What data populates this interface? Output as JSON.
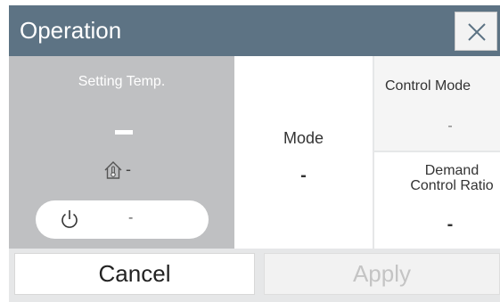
{
  "dialog": {
    "title": "Operation",
    "close_icon": "close-icon"
  },
  "setting": {
    "label": "Setting Temp.",
    "value": "-",
    "room_icon": "room-temperature-icon",
    "room_value": "-",
    "power_icon": "power-icon",
    "power_value": "-"
  },
  "mode": {
    "label": "Mode",
    "value": "-"
  },
  "control_mode": {
    "label": "Control Mode",
    "value": "-"
  },
  "demand": {
    "label_line1": "Demand",
    "label_line2": "Control Ratio",
    "value": "-"
  },
  "buttons": {
    "cancel": "Cancel",
    "apply": "Apply"
  },
  "colors": {
    "titlebar": "#5d7384",
    "left_panel": "#bfc0c2",
    "apply_disabled_text": "#c4c4c4"
  }
}
